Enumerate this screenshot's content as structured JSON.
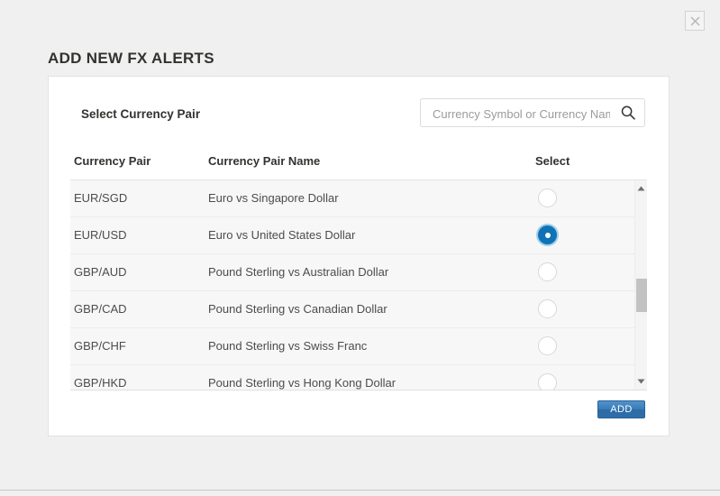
{
  "window": {
    "close_label": "×",
    "close_icon": "close-icon"
  },
  "header": {
    "title": "ADD NEW FX ALERTS"
  },
  "panel": {
    "label": "Select Currency Pair",
    "search": {
      "placeholder": "Currency Symbol or Currency Name",
      "value": "",
      "icon": "search-icon"
    }
  },
  "table": {
    "columns": [
      {
        "key": "pair",
        "label": "Currency Pair"
      },
      {
        "key": "name",
        "label": "Currency Pair Name"
      },
      {
        "key": "select",
        "label": "Select"
      }
    ],
    "rows": [
      {
        "pair": "EUR/SGD",
        "name": "Euro vs Singapore Dollar",
        "selected": false
      },
      {
        "pair": "EUR/USD",
        "name": "Euro vs United States Dollar",
        "selected": true
      },
      {
        "pair": "GBP/AUD",
        "name": "Pound Sterling vs Australian Dollar",
        "selected": false
      },
      {
        "pair": "GBP/CAD",
        "name": "Pound Sterling vs Canadian Dollar",
        "selected": false
      },
      {
        "pair": "GBP/CHF",
        "name": "Pound Sterling vs Swiss Franc",
        "selected": false
      },
      {
        "pair": "GBP/HKD",
        "name": "Pound Sterling vs Hong Kong Dollar",
        "selected": false
      }
    ],
    "scrollbar": {
      "up_icon": "scroll-up-arrow-icon",
      "down_icon": "scroll-down-arrow-icon",
      "thumb_top_pct": 47,
      "thumb_height_pct": 16
    }
  },
  "footer": {
    "add_label": "ADD"
  },
  "colors": {
    "accent_blue": "#0f72b5",
    "button_blue": "#3a7cb8",
    "page_background": "#f0f0f0",
    "card_background": "#ffffff",
    "row_background": "#f7f7f7",
    "text": "#4c4c4c",
    "heading": "#33322f"
  }
}
